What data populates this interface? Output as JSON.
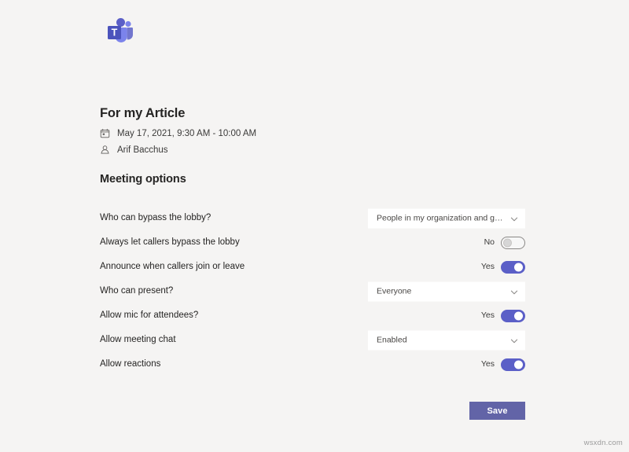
{
  "app": {
    "logo_name": "microsoft-teams-logo",
    "brand_color": "#5b5fc7",
    "accent_color": "#6264a7",
    "background_color": "#f5f4f3"
  },
  "meeting": {
    "title": "For my Article",
    "date_icon": "calendar-icon",
    "datetime": "May 17, 2021, 9:30 AM - 10:00 AM",
    "organizer_icon": "person-icon",
    "organizer": "Arif Bacchus"
  },
  "section": {
    "heading": "Meeting options"
  },
  "options": [
    {
      "label": "Who can bypass the lobby?",
      "control": "dropdown",
      "value": "People in my organization and gu…"
    },
    {
      "label": "Always let callers bypass the lobby",
      "control": "toggle",
      "state_label": "No",
      "on": false
    },
    {
      "label": "Announce when callers join or leave",
      "control": "toggle",
      "state_label": "Yes",
      "on": true
    },
    {
      "label": "Who can present?",
      "control": "dropdown",
      "value": "Everyone"
    },
    {
      "label": "Allow mic for attendees?",
      "control": "toggle",
      "state_label": "Yes",
      "on": true
    },
    {
      "label": "Allow meeting chat",
      "control": "dropdown",
      "value": "Enabled"
    },
    {
      "label": "Allow reactions",
      "control": "toggle",
      "state_label": "Yes",
      "on": true
    }
  ],
  "footer": {
    "save_label": "Save",
    "watermark": "wsxdn.com"
  }
}
